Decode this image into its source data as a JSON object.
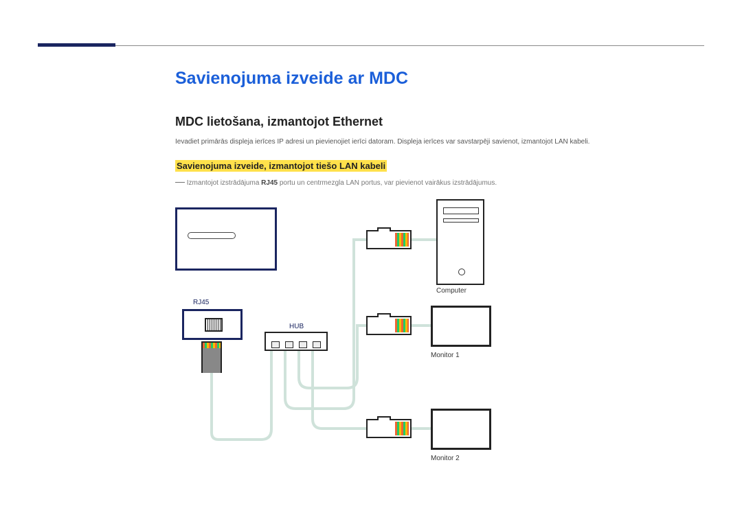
{
  "title": "Savienojuma izveide ar MDC",
  "section": "MDC lietošana, izmantojot Ethernet",
  "intro": "Ievadiet primārās displeja ierīces IP adresi un pievienojiet ierīci datoram. Displeja ierīces var savstarpēji savienot, izmantojot LAN kabeli.",
  "subsection": "Savienojuma izveide, izmantojot tiešo LAN kabeli",
  "note_prefix": "―",
  "note_text_before": "Izmantojot izstrādājuma ",
  "note_bold": "RJ45",
  "note_text_after": " portu un centrmezgla LAN portus, var pievienot vairākus izstrādājumus.",
  "labels": {
    "rj45": "RJ45",
    "hub": "HUB",
    "computer": "Computer",
    "monitor1": "Monitor 1",
    "monitor2": "Monitor 2"
  }
}
